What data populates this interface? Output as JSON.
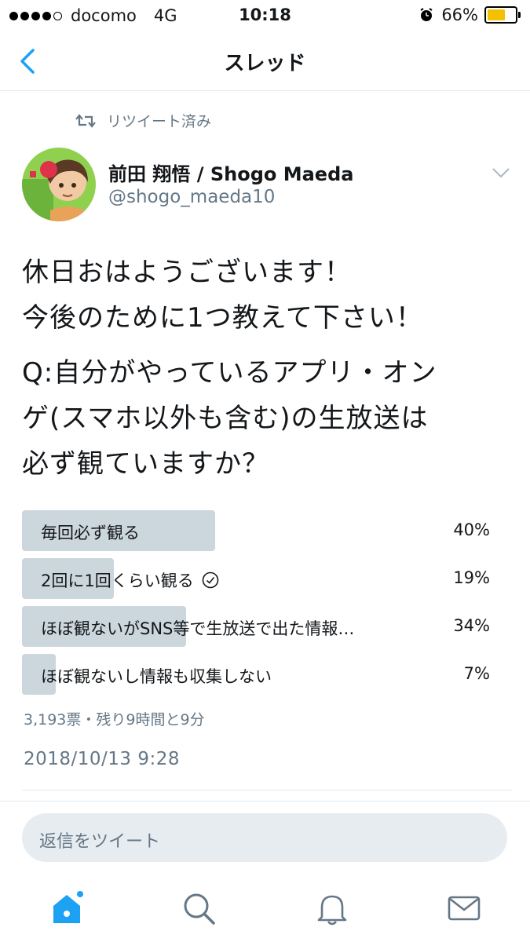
{
  "status_bar": {
    "carrier": "docomo",
    "network": "4G",
    "time": "10:18",
    "battery": "66%",
    "battery_color": "#f4c100"
  },
  "nav": {
    "title": "スレッド",
    "back_icon": "chevron-left-icon"
  },
  "tweet": {
    "retweet_label": "リツイート済み",
    "author_name": "前田 翔悟 / Shogo Maeda",
    "author_handle": "@shogo_maeda10",
    "text_lines_1": [
      "休日おはようございます！",
      "今後のために1つ教えて下さい！"
    ],
    "text_lines_2": [
      "Q:自分がやっているアプリ・オン",
      "ゲ(スマホ以外も含む)の生放送は",
      "必ず観ていますか？"
    ],
    "poll": {
      "options": [
        {
          "label": "毎回必ず観る",
          "percent_label": "40%",
          "percent": 40,
          "selected": false
        },
        {
          "label": "2回に1回くらい観る",
          "percent_label": "19%",
          "percent": 19,
          "selected": true
        },
        {
          "label": "ほぼ観ないがSNS等で生放送で出た情報…",
          "percent_label": "34%",
          "percent": 34,
          "selected": false
        },
        {
          "label": "ほぼ観ないし情報も収集しない",
          "percent_label": "7%",
          "percent": 7,
          "selected": false
        }
      ],
      "meta": "3,193票・残り9時間と9分"
    },
    "timestamp": "2018/10/13 9:28"
  },
  "reply": {
    "placeholder": "返信をツイート"
  },
  "tab_bar": {
    "accent_color": "#1da1f2",
    "tabs": [
      "home-icon",
      "search-icon",
      "bell-icon",
      "mail-icon"
    ]
  }
}
